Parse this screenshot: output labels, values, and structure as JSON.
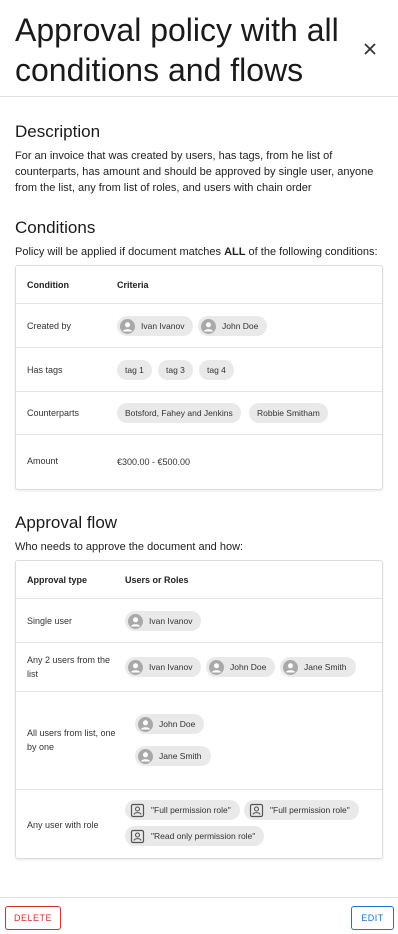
{
  "header": {
    "title": "Approval policy with all conditions and flows"
  },
  "description": {
    "heading": "Description",
    "text": "For an invoice that was created by users, has tags, from he list of counterparts, has amount and should be approved by single user, anyone from the list, any from list of roles, and users with chain order"
  },
  "conditions": {
    "heading": "Conditions",
    "intro_before": "Policy will be applied if document matches ",
    "intro_bold": "ALL",
    "intro_after": " of the following conditions:",
    "col_condition": "Condition",
    "col_criteria": "Criteria",
    "rows": [
      {
        "label": "Created by",
        "chips": [
          "Ivan Ivanov",
          "John Doe"
        ]
      },
      {
        "label": "Has tags",
        "chips": [
          "tag 1",
          "tag 3",
          "tag 4"
        ]
      },
      {
        "label": "Counterparts",
        "chips": [
          "Botsford, Fahey and Jenkins",
          "Robbie Smitham"
        ]
      },
      {
        "label": "Amount",
        "value": "€300.00 - €500.00"
      }
    ]
  },
  "approval_flow": {
    "heading": "Approval flow",
    "intro": "Who needs to approve the document and how:",
    "col_type": "Approval type",
    "col_users": "Users or Roles",
    "rows": [
      {
        "label": "Single user",
        "chips": [
          "Ivan Ivanov"
        ]
      },
      {
        "label": "Any 2 users from the list",
        "chips": [
          "Ivan Ivanov",
          "John Doe",
          "Jane Smith"
        ]
      },
      {
        "label": "All users from list, one by one",
        "chips": [
          "John Doe",
          "Jane Smith"
        ]
      },
      {
        "label": "Any user with role",
        "chips": [
          "\"Full permission role\"",
          "\"Full permission role\"",
          "\"Read only permission role\""
        ]
      }
    ]
  },
  "footer": {
    "delete_label": "DELETE",
    "edit_label": "EDIT"
  },
  "colors": {
    "delete": "#d32f2f",
    "edit": "#1976d2",
    "chip_bg": "#e9e9e9"
  },
  "icons": {
    "close": "close-icon",
    "user": "user-avatar-icon",
    "role": "role-badge-icon"
  }
}
